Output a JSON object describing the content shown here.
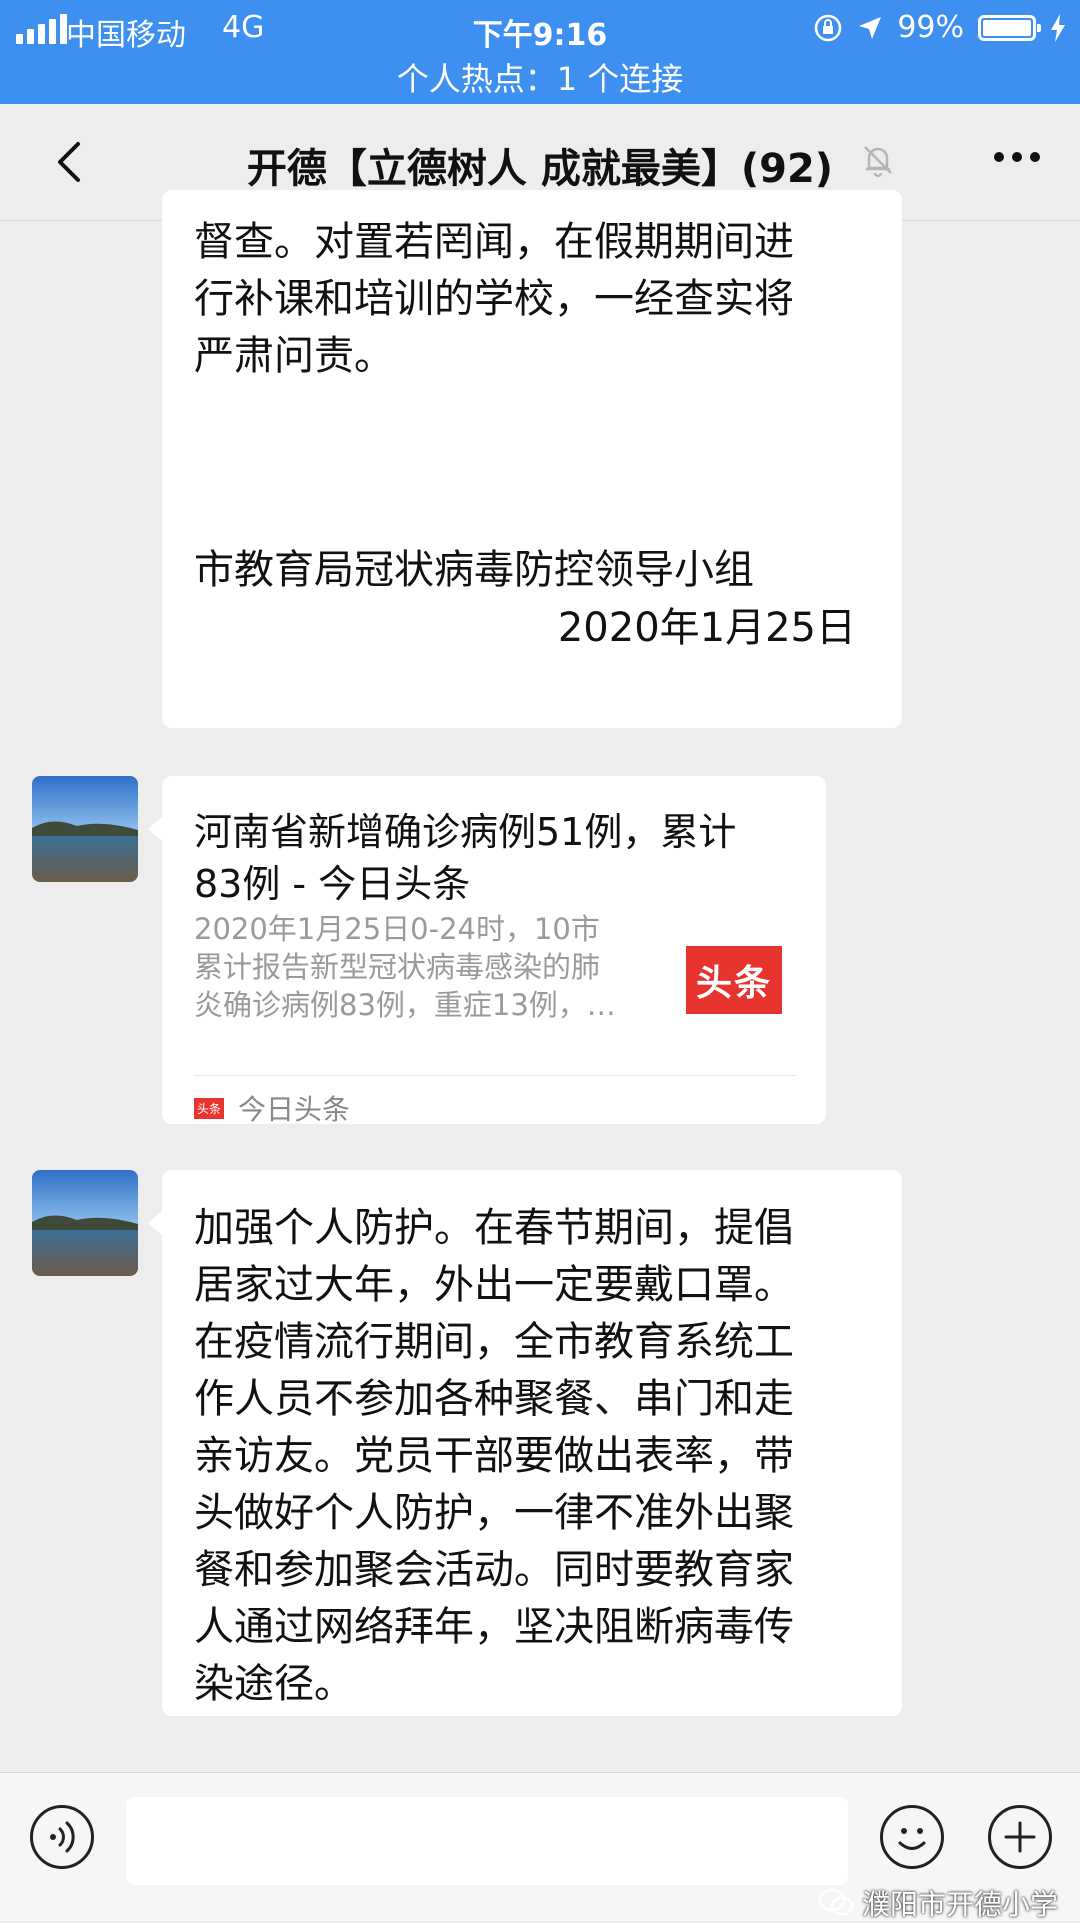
{
  "status_bar": {
    "carrier": "中国移动",
    "network": "4G",
    "time": "下午9:16",
    "battery": "99%",
    "battery_level": 0.99,
    "hotspot": "个人热点：1 个连接"
  },
  "header": {
    "title": "开德【立德树人 成就最美】(92)",
    "back_icon": "chevron-left-icon",
    "mute_icon": "bell-muted-icon",
    "more_icon": "more-dots-icon"
  },
  "messages": [
    {
      "type": "text",
      "lines": [
        "督查。对置若罔闻，在假期期间进",
        "行补课和培训的学校，一经查实将",
        "严肃问责。"
      ],
      "signature": "市教育局冠状病毒防控领导小组",
      "date": "2020年1月25日"
    },
    {
      "type": "link",
      "title_lines": [
        "河南省新增确诊病例51例，累计",
        "83例 - 今日头条"
      ],
      "desc_lines": [
        "2020年1月25日0-24时，10市",
        "累计报告新型冠状病毒感染的肺",
        "炎确诊病例83例，重症13例，…"
      ],
      "thumb_label": "头条",
      "source_icon_label": "头条",
      "source": "今日头条"
    },
    {
      "type": "text",
      "lines": [
        "加强个人防护。在春节期间，提倡",
        "居家过大年，外出一定要戴口罩。",
        "在疫情流行期间，全市教育系统工",
        "作人员不参加各种聚餐、串门和走",
        "亲访友。党员干部要做出表率，带",
        "头做好个人防护，一律不准外出聚",
        "餐和参加聚会活动。同时要教育家",
        "人通过网络拜年，坚决阻断病毒传",
        "染途径。"
      ]
    }
  ],
  "input_bar": {
    "voice_icon": "voice-icon",
    "emoji_icon": "emoji-icon",
    "plus_icon": "plus-icon"
  },
  "watermark": "濮阳市开德小学",
  "colors": {
    "status_bar": "#3d8ff0",
    "background": "#ededed",
    "bubble": "#ffffff",
    "toutiao_red": "#e8342f"
  }
}
